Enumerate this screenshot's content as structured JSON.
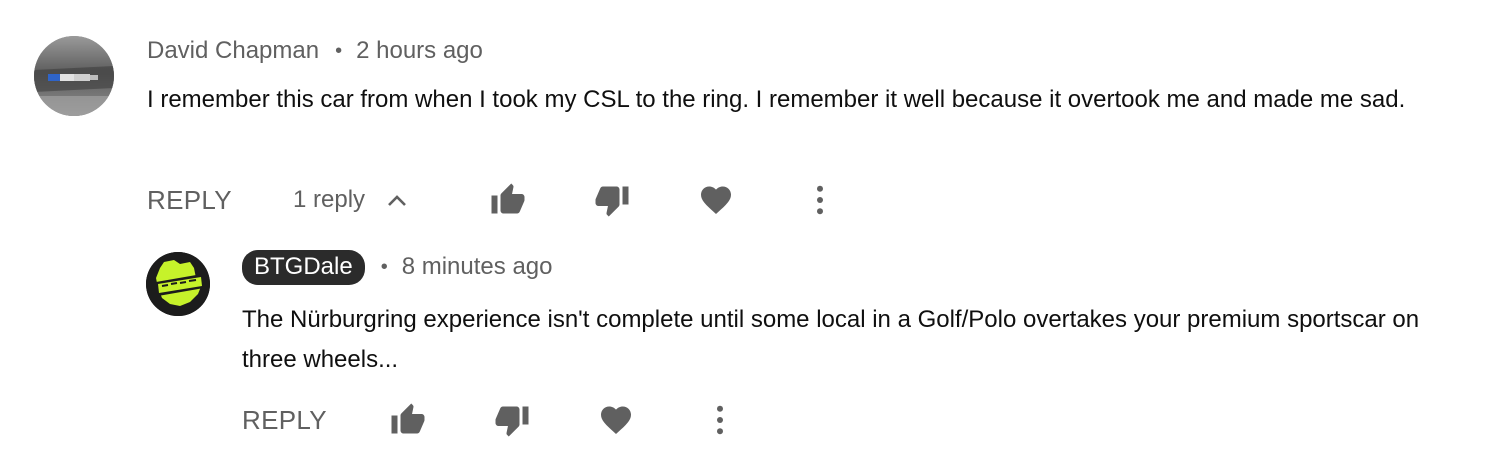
{
  "comments": [
    {
      "author": "David Chapman",
      "time": "2 hours ago",
      "text": "I remember this car from when I took my CSL to the ring. I remember it well because it overtook me and made me sad.",
      "reply_label": "REPLY",
      "replies_count_label": "1 reply",
      "avatar_icon": "car-badge-avatar"
    }
  ],
  "replies": [
    {
      "author": "BTGDale",
      "time": "8 minutes ago",
      "text": "The Nürburgring experience isn't complete until some local in a Golf/Polo overtakes your premium sportscar on three wheels...",
      "reply_label": "REPLY",
      "avatar_icon": "nurburgring-logo-avatar"
    }
  ],
  "separator": "•",
  "icons": [
    "thumbs-up-icon",
    "thumbs-down-icon",
    "heart-icon",
    "more-vert-icon",
    "chevron-up-icon"
  ],
  "colors": {
    "text": "#0f0f0f",
    "secondary": "#606060",
    "author_pill_bg": "#2b2b2b",
    "logo_green": "#c6f22a"
  }
}
